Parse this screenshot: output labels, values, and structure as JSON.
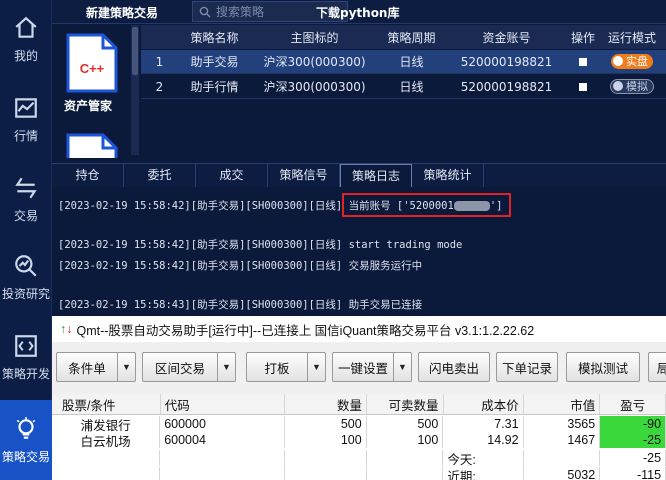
{
  "leftnav": {
    "items": [
      {
        "label": "我的",
        "icon": "home-icon"
      },
      {
        "label": "行情",
        "icon": "chart-icon"
      },
      {
        "label": "交易",
        "icon": "trade-icon"
      },
      {
        "label": "投资研究",
        "icon": "research-icon"
      },
      {
        "label": "策略开发",
        "icon": "code-icon"
      },
      {
        "label": "策略交易",
        "icon": "bulb-icon",
        "active": true
      }
    ]
  },
  "header": {
    "new_strategy": "新建策略交易",
    "search_placeholder": "搜索策略",
    "download": "下载python库"
  },
  "asset": {
    "icon_text": "C++",
    "label": "资产管家"
  },
  "strategy_table": {
    "columns": [
      "",
      "策略名称",
      "主图标的",
      "策略周期",
      "资金账号",
      "操作",
      "运行模式"
    ],
    "rows": [
      {
        "index": "1",
        "name": "助手交易",
        "symbol": "沪深300(000300)",
        "period": "日线",
        "account": "520000198821",
        "mode": "实盘",
        "mode_on": true
      },
      {
        "index": "2",
        "name": "助手行情",
        "symbol": "沪深300(000300)",
        "period": "日线",
        "account": "520000198821",
        "mode": "模拟",
        "mode_on": false
      }
    ]
  },
  "tabs": [
    "持仓",
    "委托",
    "成交",
    "策略信号",
    "策略日志",
    "策略统计"
  ],
  "active_tab": "策略日志",
  "log": {
    "line1_prefix": "[2023-02-19 15:58:42][助手交易][SH000300][日线]",
    "line1_msg": "当前账号 ['5200001",
    "line1_end": "']",
    "line2": "[2023-02-19 15:58:42][助手交易][SH000300][日线] start trading mode",
    "line3": "[2023-02-19 15:58:42][助手交易][SH000300][日线] 交易服务运行中",
    "line4": "[2023-02-19 15:58:43][助手交易][SH000300][日线] 助手交易已连接"
  },
  "qmt": {
    "title": "Qmt--股票自动交易助手[运行中]--已连接上 国信iQuant策略交易平台 v3.1:1.2.22.62",
    "buttons": [
      "条件单",
      "区间交易",
      "打板",
      "一键设置",
      "闪电卖出",
      "下单记录",
      "模拟测试",
      "局"
    ],
    "columns": [
      "股票/条件",
      "代码",
      "数量",
      "可卖数量",
      "成本价",
      "市值",
      "盈亏"
    ],
    "rows": [
      {
        "name": "浦发银行",
        "code": "600000",
        "qty": "500",
        "sellable": "500",
        "cost": "7.31",
        "value": "3565",
        "pnl": "-90"
      },
      {
        "name": "白云机场",
        "code": "600004",
        "qty": "100",
        "sellable": "100",
        "cost": "14.92",
        "value": "1467",
        "pnl": "-25"
      }
    ],
    "today_label": "今天:",
    "today_value": "-25",
    "recent_label": "近期:",
    "recent_value": "5032",
    "recent_pnl": "-115"
  },
  "colors": {
    "bg": "#0b1a3a",
    "active_nav": "#1753c7",
    "toggle_on": "#f07c1b",
    "highlight_box": "#e02424",
    "pnl_green": "#3bd83b"
  }
}
